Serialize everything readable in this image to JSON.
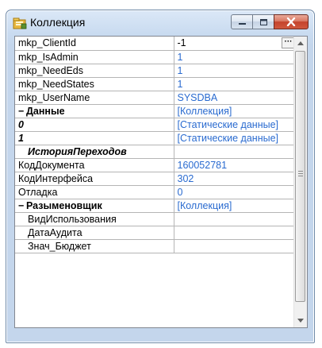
{
  "window": {
    "title": "Коллекция",
    "icon": "folder-collection-icon",
    "buttons": {
      "minimize": "minimize-icon",
      "maximize": "maximize-icon",
      "close": "close-icon"
    }
  },
  "grid": {
    "rows": [
      {
        "name": "mkp_ClientId",
        "value": "-1",
        "type": "prop",
        "selected": true,
        "has_button": true,
        "button_label": "···"
      },
      {
        "name": "mkp_IsAdmin",
        "value": "1",
        "type": "prop"
      },
      {
        "name": "mkp_NeedEds",
        "value": "1",
        "type": "prop"
      },
      {
        "name": "mkp_NeedStates",
        "value": "1",
        "type": "prop"
      },
      {
        "name": "mkp_UserName",
        "value": "SYSDBA",
        "type": "prop"
      },
      {
        "name": "Данные",
        "value": "[Коллекция]",
        "type": "category",
        "toggle": "−"
      },
      {
        "name": "0",
        "value": "[Статические данные]",
        "type": "italic"
      },
      {
        "name": "1",
        "value": "[Статические данные]",
        "type": "italic"
      },
      {
        "name": "ИсторияПереходов",
        "value": "",
        "type": "italic-top"
      },
      {
        "name": "КодДокумента",
        "value": "160052781",
        "type": "prop"
      },
      {
        "name": "КодИнтерфейса",
        "value": "302",
        "type": "prop"
      },
      {
        "name": "Отладка",
        "value": "0",
        "type": "prop"
      },
      {
        "name": "Разыменовщик",
        "value": "[Коллекция]",
        "type": "category",
        "toggle": "−"
      },
      {
        "name": "ВидИспользования",
        "value": "",
        "type": "child"
      },
      {
        "name": "ДатаАудита",
        "value": "",
        "type": "child"
      },
      {
        "name": "Знач_Бюджет",
        "value": "",
        "type": "child"
      }
    ]
  },
  "scrollbar": {
    "up": "scroll-up-arrow-icon",
    "down": "scroll-down-arrow-icon"
  }
}
